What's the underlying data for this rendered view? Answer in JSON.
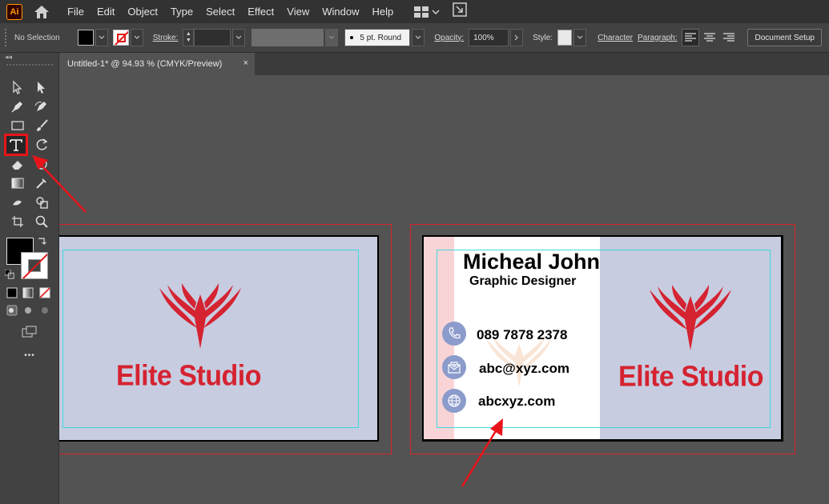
{
  "app": {
    "logo_text": "Ai"
  },
  "menu": {
    "items": [
      "File",
      "Edit",
      "Object",
      "Type",
      "Select",
      "Effect",
      "View",
      "Window",
      "Help"
    ]
  },
  "control_bar": {
    "selection_status": "No Selection",
    "stroke_label": "Stroke:",
    "brush_value": "5 pt. Round",
    "opacity_label": "Opacity:",
    "opacity_value": "100%",
    "style_label": "Style:",
    "character_label": "Character",
    "paragraph_label": "Paragraph:",
    "document_setup_label": "Document Setup"
  },
  "document_tab": {
    "title": "Untitled-1* @ 94.93 % (CMYK/Preview)",
    "close_glyph": "×"
  },
  "toolbar": {
    "more_glyph": "•••",
    "collapse_glyph": "◂◂"
  },
  "artboards": {
    "back_card": {
      "brand": "Elite Studio"
    },
    "front_card": {
      "name": "Micheal John",
      "role": "Graphic Designer",
      "phone": "089 7878 2378",
      "email": "abc@xyz.com",
      "website": "abcxyz.com",
      "brand": "Elite Studio"
    }
  },
  "colors": {
    "brand_red": "#d52331",
    "card_bg": "#c7cce0",
    "icon_circle": "#8b9bcb",
    "pink_strip": "#f9d4d6",
    "guide": "#3fd8e0",
    "bleed": "#d9232a",
    "annotation_arrow": "#e8141a"
  }
}
